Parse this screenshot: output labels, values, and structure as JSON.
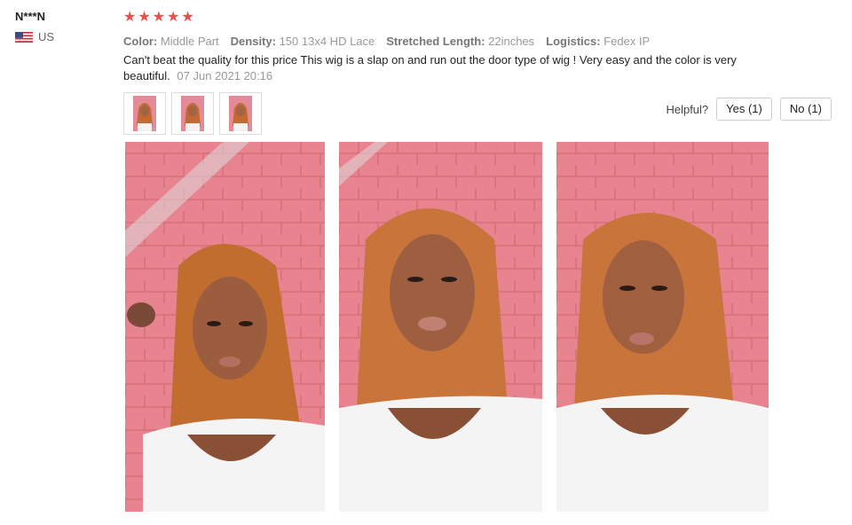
{
  "reviewer": {
    "name": "N***N",
    "country": "US",
    "flag_icon": "us-flag-icon"
  },
  "review": {
    "rating": 5,
    "star_color": "#e94d4d",
    "attributes": [
      {
        "key": "Color:",
        "value": "Middle Part"
      },
      {
        "key": "Density:",
        "value": "150 13x4 HD Lace"
      },
      {
        "key": "Stretched Length:",
        "value": "22inches"
      },
      {
        "key": "Logistics:",
        "value": "Fedex IP"
      }
    ],
    "text": "Can't beat the quality for this price This wig is a slap on and run out the door type of wig ! Very easy and the color is very beautiful.",
    "date": "07 Jun 2021 20:16"
  },
  "helpful": {
    "label": "Helpful?",
    "yes": "Yes (1)",
    "no": "No (1)"
  },
  "photos": [
    {
      "icon": "review-photo-1"
    },
    {
      "icon": "review-photo-2"
    },
    {
      "icon": "review-photo-3"
    }
  ]
}
